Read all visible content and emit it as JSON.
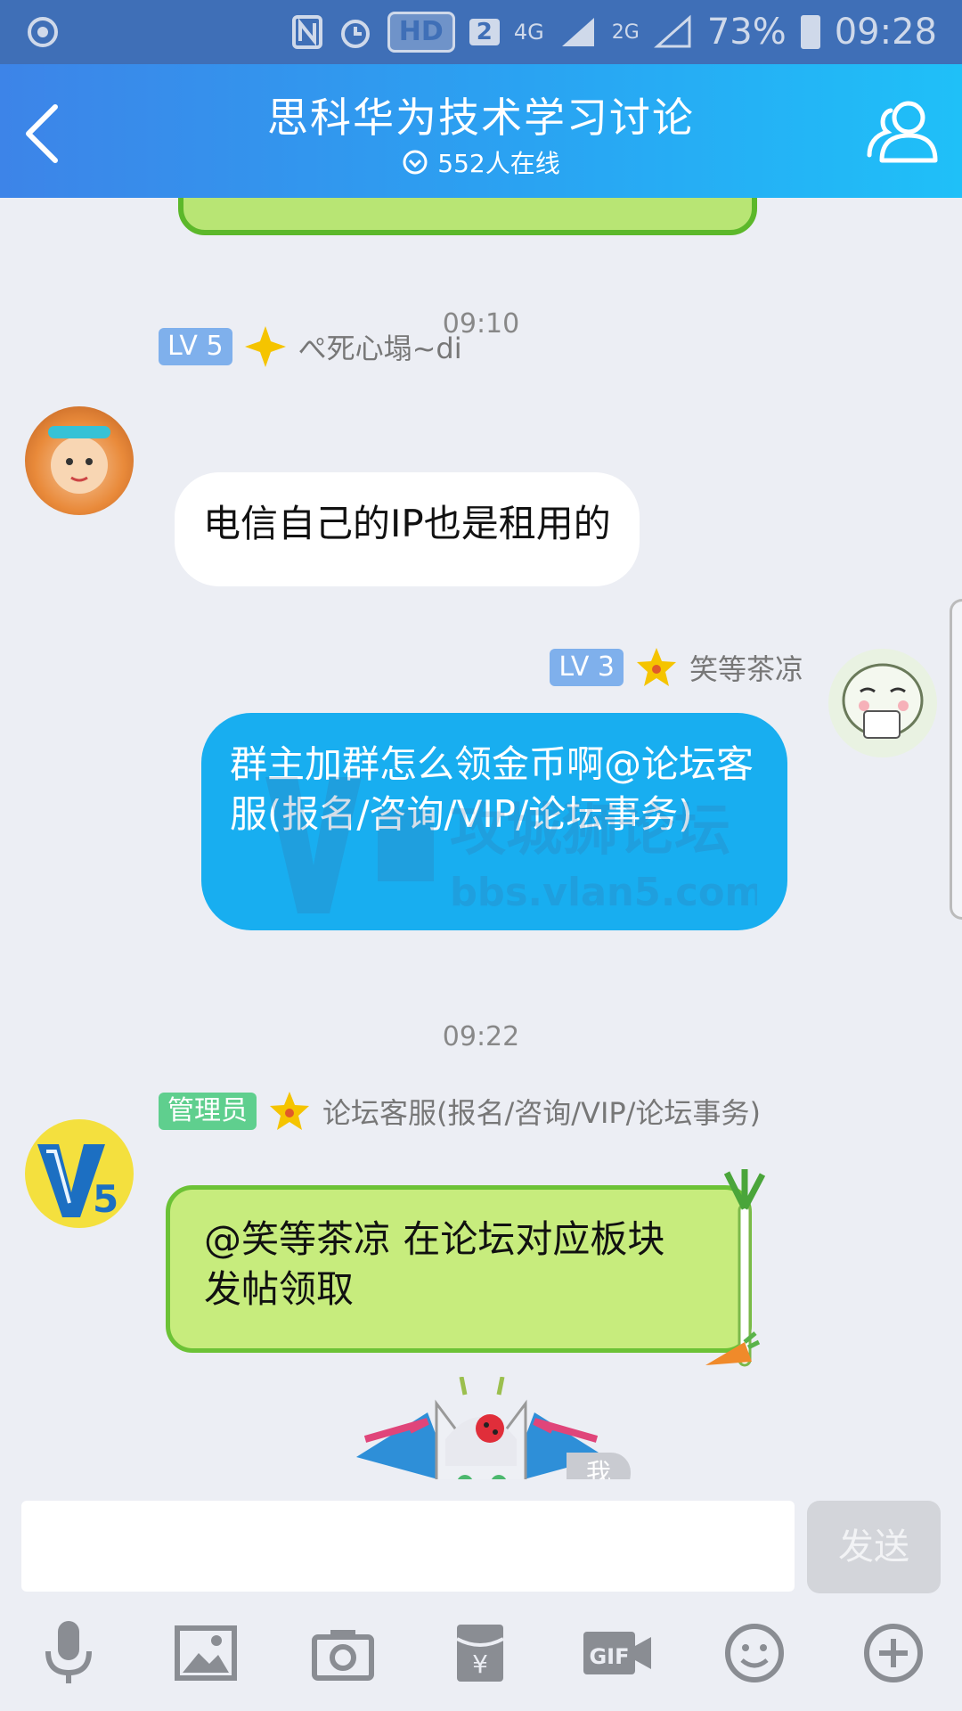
{
  "status_bar": {
    "network": "4G",
    "network2": "2G",
    "hd": "HD",
    "sim": "2",
    "battery": "73%",
    "time": "09:28"
  },
  "header": {
    "title": "思科华为技术学习讨论",
    "online": "552人在线"
  },
  "messages": [
    {
      "time": "09:10",
      "level": "LV 5",
      "sender": "ぺ死心塌~di",
      "text": "电信自己的IP也是租用的"
    },
    {
      "level": "LV 3",
      "sender": "笑等茶凉",
      "text": "群主加群怎么领金币啊@论坛客服(报名/咨询/VIP/论坛事务)"
    },
    {
      "time": "09:22",
      "role": "管理员",
      "sender": "论坛客服(报名/咨询/VIP/论坛事务)",
      "text_line1": "@笑等茶凉 在论坛对应板块",
      "text_line2": "发帖领取"
    }
  ],
  "watermark": {
    "name": "攻城狮论坛",
    "url": "bbs.vlan5.com"
  },
  "self_label": "我",
  "input": {
    "value": "",
    "send_label": "发送"
  },
  "toolbar": [
    "microphone-icon",
    "image-icon",
    "camera-icon",
    "red-packet-icon",
    "gif-icon",
    "emoji-icon",
    "plus-icon"
  ],
  "colors": {
    "header_start": "#3d84e8",
    "header_end": "#1fc0f8",
    "blue_bubble": "#18aef0",
    "green_bubble": "#c7ec7d"
  }
}
